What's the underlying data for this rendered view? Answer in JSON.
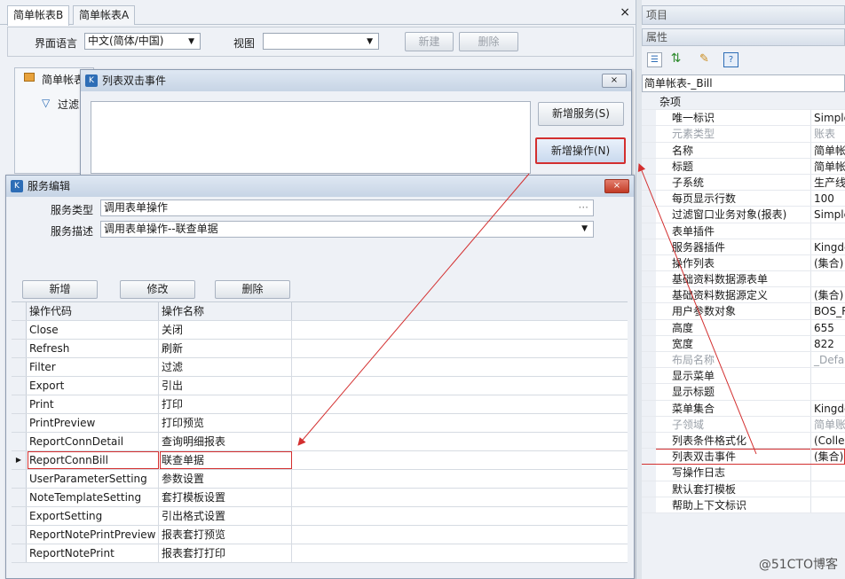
{
  "tabs": [
    "简单帐表B",
    "简单帐表A"
  ],
  "tab_close": "×",
  "toolbar": {
    "lang_label": "界面语言",
    "lang_value": "中文(简体/中国)",
    "view_label": "视图",
    "view_value": "",
    "new_btn": "新建",
    "delete_btn": "删除"
  },
  "bg_panel": {
    "title": "简单帐表",
    "filter": "过滤"
  },
  "dlg1": {
    "title": "列表双击事件",
    "close": "×",
    "btn_add_service": "新增服务(S)",
    "btn_add_op": "新增操作(N)"
  },
  "dlg2": {
    "title": "服务编辑",
    "close": "×",
    "service_type_label": "服务类型",
    "service_type_value": "调用表单操作",
    "service_type_ellipsis": "···",
    "service_desc_label": "服务描述",
    "service_desc_value": "调用表单操作--联查单据",
    "btn_add": "新增",
    "btn_modify": "修改",
    "btn_delete": "删除",
    "col_code": "操作代码",
    "col_name": "操作名称",
    "rows": [
      {
        "code": "Close",
        "name": "关闭"
      },
      {
        "code": "Refresh",
        "name": "刷新"
      },
      {
        "code": "Filter",
        "name": "过滤"
      },
      {
        "code": "Export",
        "name": "引出"
      },
      {
        "code": "Print",
        "name": "打印"
      },
      {
        "code": "PrintPreview",
        "name": "打印预览"
      },
      {
        "code": "ReportConnDetail",
        "name": "查询明细报表"
      },
      {
        "code": "ReportConnBill",
        "name": "联查单据"
      },
      {
        "code": "UserParameterSetting",
        "name": "参数设置"
      },
      {
        "code": "NoteTemplateSetting",
        "name": "套打模板设置"
      },
      {
        "code": "ExportSetting",
        "name": "引出格式设置"
      },
      {
        "code": "ReportNotePrintPreview",
        "name": "报表套打预览"
      },
      {
        "code": "ReportNotePrint",
        "name": "报表套打打印"
      }
    ],
    "selected_marker": "▶"
  },
  "right": {
    "project_title": "项目",
    "props_title": "属性",
    "object_name": "简单帐表-_Bill",
    "category": "杂项",
    "props": [
      {
        "name": "唯一标识",
        "value": "Simple"
      },
      {
        "name": "元素类型",
        "value": "账表"
      },
      {
        "name": "名称",
        "value": "简单帐"
      },
      {
        "name": "标题",
        "value": "简单帐"
      },
      {
        "name": "子系统",
        "value": "生产线"
      },
      {
        "name": "每页显示行数",
        "value": "100"
      },
      {
        "name": "过滤窗口业务对象(报表)",
        "value": "Simple"
      },
      {
        "name": "表单插件",
        "value": ""
      },
      {
        "name": "服务器插件",
        "value": "Kingde"
      },
      {
        "name": "操作列表",
        "value": "(集合)"
      },
      {
        "name": "基础资料数据源表单",
        "value": ""
      },
      {
        "name": "基础资料数据源定义",
        "value": "(集合)"
      },
      {
        "name": "用户参数对象",
        "value": "BOS_R"
      },
      {
        "name": "高度",
        "value": "655"
      },
      {
        "name": "宽度",
        "value": "822"
      },
      {
        "name": "布局名称",
        "value": "_Defau"
      },
      {
        "name": "显示菜单",
        "value": ""
      },
      {
        "name": "显示标题",
        "value": ""
      },
      {
        "name": "菜单集合",
        "value": "Kingde"
      },
      {
        "name": "子领域",
        "value": "简单账"
      },
      {
        "name": "列表条件格式化",
        "value": "(Collec"
      },
      {
        "name": "列表双击事件",
        "value": "(集合)"
      },
      {
        "name": "写操作日志",
        "value": ""
      },
      {
        "name": "默认套打模板",
        "value": ""
      },
      {
        "name": "帮助上下文标识",
        "value": ""
      }
    ],
    "gray_rows": [
      1,
      15,
      19
    ],
    "highlight_row": 21
  },
  "watermark": "@51CTO博客",
  "colors": {
    "highlight": "#d32f2f",
    "accent": "#2d6db6"
  }
}
